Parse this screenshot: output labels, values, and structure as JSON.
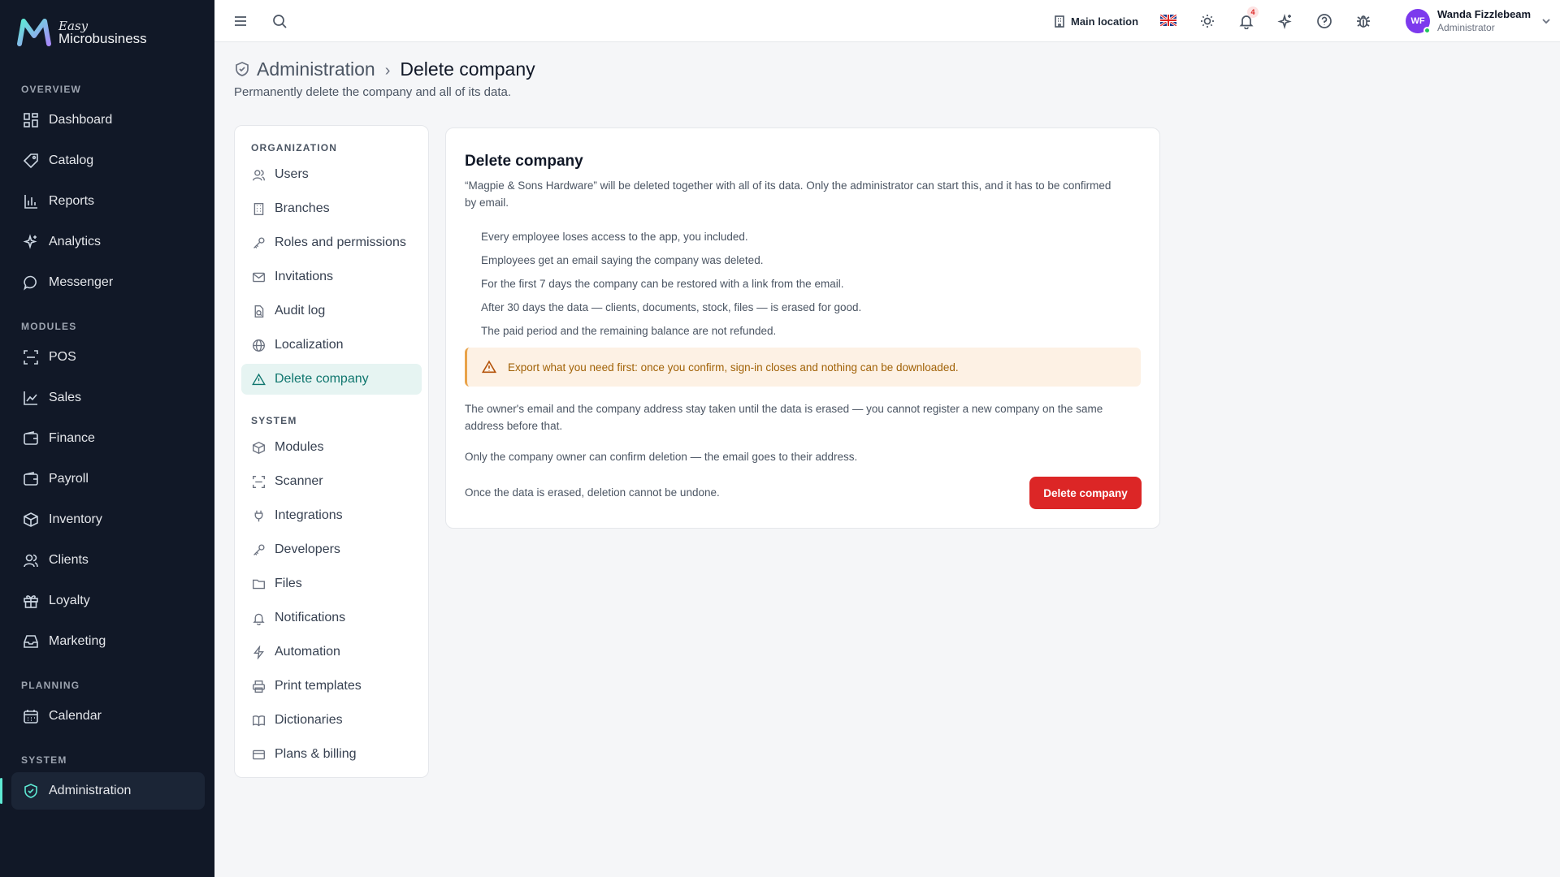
{
  "brand": {
    "line1": "Easy",
    "line2": "Microbusiness"
  },
  "colors": {
    "sidebar_bg": "#111827",
    "accent": "#5eead4",
    "danger": "#dc2626",
    "warning_bg": "#fdf1e4",
    "avatar_bg": "#7c3aed"
  },
  "sidebar": {
    "sections": [
      {
        "title": "OVERVIEW",
        "items": [
          {
            "label": "Dashboard",
            "icon": "grid-icon"
          },
          {
            "label": "Catalog",
            "icon": "tag-icon"
          },
          {
            "label": "Reports",
            "icon": "bar-chart-icon"
          },
          {
            "label": "Analytics",
            "icon": "sparkles-icon"
          },
          {
            "label": "Messenger",
            "icon": "chat-icon"
          }
        ]
      },
      {
        "title": "MODULES",
        "items": [
          {
            "label": "POS",
            "icon": "scan-icon"
          },
          {
            "label": "Sales",
            "icon": "line-chart-icon"
          },
          {
            "label": "Finance",
            "icon": "wallet-icon"
          },
          {
            "label": "Payroll",
            "icon": "wallet-icon"
          },
          {
            "label": "Inventory",
            "icon": "box-icon"
          },
          {
            "label": "Clients",
            "icon": "users-icon"
          },
          {
            "label": "Loyalty",
            "icon": "gift-icon"
          },
          {
            "label": "Marketing",
            "icon": "inbox-icon"
          }
        ]
      },
      {
        "title": "PLANNING",
        "items": [
          {
            "label": "Calendar",
            "icon": "calendar-icon"
          }
        ]
      },
      {
        "title": "SYSTEM",
        "items": [
          {
            "label": "Administration",
            "icon": "shield-icon",
            "active": true
          }
        ]
      }
    ]
  },
  "topbar": {
    "location": "Main location",
    "notifications_count": "4",
    "user": {
      "initials": "WF",
      "name": "Wanda Fizzlebeam",
      "role": "Administrator"
    }
  },
  "header": {
    "parent": "Administration",
    "separator": "›",
    "current": "Delete company",
    "subtitle": "Permanently delete the company and all of its data."
  },
  "settings_nav": {
    "organization_title": "ORGANIZATION",
    "organization": [
      "Users",
      "Branches",
      "Roles and permissions",
      "Invitations",
      "Audit log",
      "Localization",
      "Delete company"
    ],
    "system_title": "SYSTEM",
    "system": [
      "Modules",
      "Scanner",
      "Integrations",
      "Developers",
      "Files",
      "Notifications",
      "Automation",
      "Print templates",
      "Dictionaries",
      "Plans & billing"
    ]
  },
  "card": {
    "title": "Delete company",
    "intro": "“Magpie & Sons Hardware” will be deleted together with all of its data. Only the administrator can start this, and it has to be confirmed by email.",
    "bullets": [
      "Every employee loses access to the app, you included.",
      "Employees get an email saying the company was deleted.",
      "For the first 7 days the company can be restored with a link from the email.",
      "After 30 days the data — clients, documents, stock, files — is erased for good.",
      "The paid period and the remaining balance are not refunded."
    ],
    "warning": "Export what you need first: once you confirm, sign-in closes and nothing can be downloaded.",
    "p1": "The owner's email and the company address stay taken until the data is erased — you cannot register a new company on the same address before that.",
    "p2": "Only the company owner can confirm deletion — the email goes to their address.",
    "p3": "Once the data is erased, deletion cannot be undone.",
    "button": "Delete company"
  }
}
